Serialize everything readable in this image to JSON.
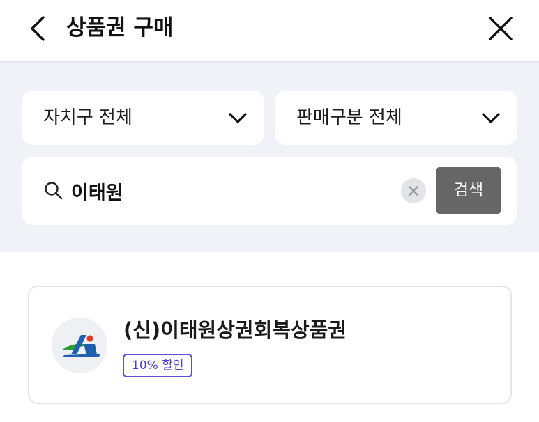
{
  "header": {
    "title": "상품권 구매",
    "back_icon": "chevron-left-icon",
    "close_icon": "close-icon"
  },
  "filters": {
    "region_select": {
      "selected": "자치구 전체",
      "icon": "chevron-down-icon"
    },
    "type_select": {
      "selected": "판매구분 전체",
      "icon": "chevron-down-icon"
    }
  },
  "search": {
    "icon": "search-icon",
    "value": "이태원",
    "clear_icon": "clear-icon",
    "button_label": "검색"
  },
  "results": [
    {
      "name": "(신)이태원상권회복상품권",
      "badge": "10% 할인",
      "logo": "district-logo"
    }
  ],
  "colors": {
    "filter_background": "#f1f2f7",
    "search_button": "#666666",
    "badge_accent": "#5a4fd8"
  }
}
